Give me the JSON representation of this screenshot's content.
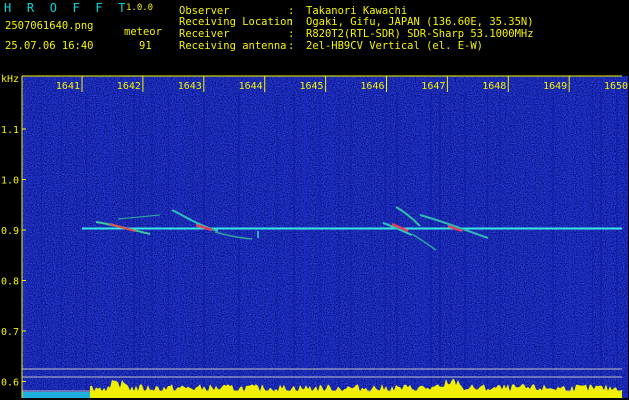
{
  "header": {
    "app_name": "H R O F F T",
    "version": "1.0.0",
    "file_name": "2507061640.png",
    "timestamp": "25.07.06 16:40",
    "meteor_label": "meteor",
    "meteor_count": "91"
  },
  "info": [
    {
      "key": "Observer",
      "value": "Takanori Kawachi"
    },
    {
      "key": "Receiving Location",
      "value": "Ogaki, Gifu, JAPAN (136.60E, 35.35N)"
    },
    {
      "key": "Receiver",
      "value": "R820T2(RTL-SDR) SDR-Sharp 53.1000MHz"
    },
    {
      "key": "Receiving antenna",
      "value": "2el-HB9CV Vertical (el. E-W)"
    }
  ],
  "separator": ":",
  "axes": {
    "y_unit": "kHz",
    "x_ticks": [
      "1641",
      "1642",
      "1643",
      "1644",
      "1645",
      "1646",
      "1647",
      "1648",
      "1649",
      "1650"
    ],
    "y_ticks": [
      "1.1",
      "1.0",
      "0.9",
      "0.8",
      "0.7",
      "0.6"
    ]
  },
  "colors": {
    "label": "#f5f500",
    "logo": "#00d8d8",
    "background_noise": "#000a8c",
    "carrier": "#38e6e6",
    "power_trace": "#f0f000"
  }
}
